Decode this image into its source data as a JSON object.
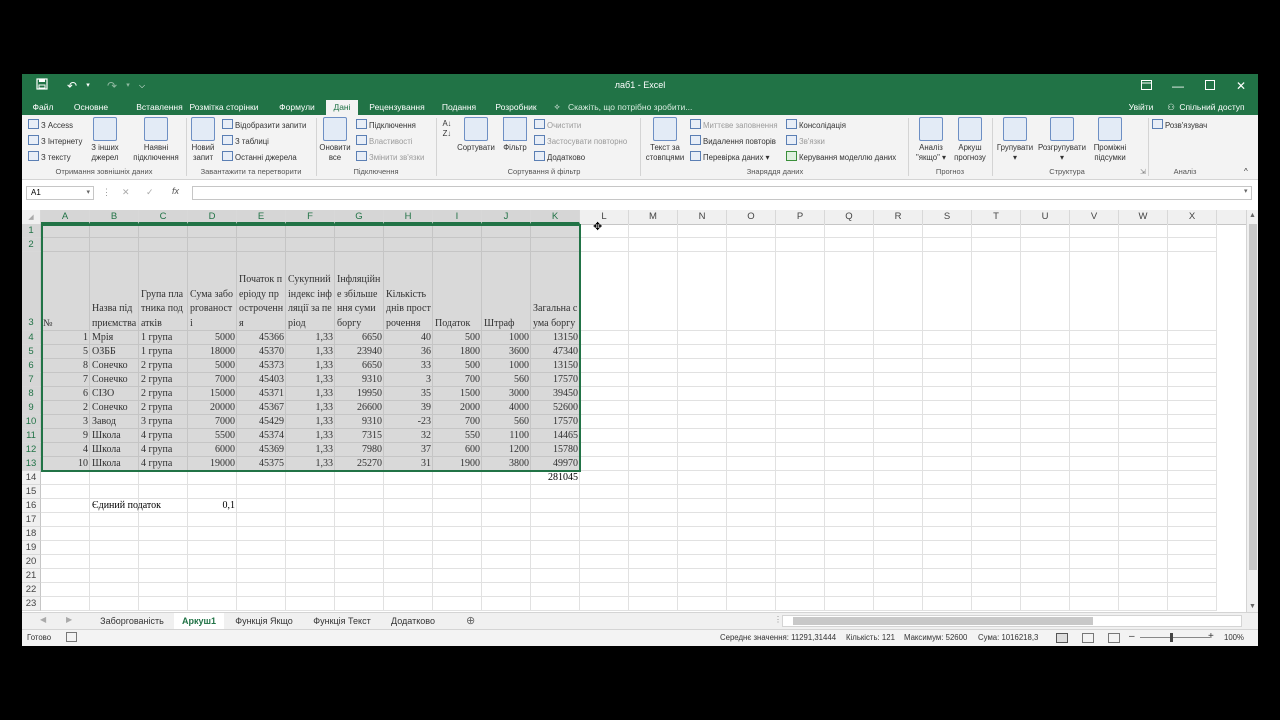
{
  "window": {
    "title": "лаб1 - Excel",
    "ribbon_display_icon": "ribbon-display-icon",
    "accent_color": "#217346"
  },
  "menu_tabs": [
    "Файл",
    "Основне",
    "Вставлення",
    "Розмітка сторінки",
    "Формули",
    "Дані",
    "Рецензування",
    "Подання",
    "Розробник"
  ],
  "active_tab": "Дані",
  "tell_me": "Скажіть, що потрібно зробити...",
  "signin": "Увійти",
  "share": "Спільний доступ",
  "ribbon": {
    "get_external": {
      "items": [
        "З Access",
        "З Інтернету",
        "З тексту"
      ],
      "big": "З інших джерел",
      "big2": "Наявні підключення",
      "label": "Отримання зовнішніх даних"
    },
    "transform": {
      "big": "Новий запит",
      "items": [
        "Відобразити запити",
        "З таблиці",
        "Останні джерела"
      ],
      "label": "Завантажити та перетворити"
    },
    "connections": {
      "big": "Оновити все",
      "items": [
        "Підключення",
        "Властивості",
        "Змінити зв'язки"
      ],
      "label": "Підключення"
    },
    "sort_filter": {
      "sort": "Сортувати",
      "filter": "Фільтр",
      "items": [
        "Очистити",
        "Застосувати повторно",
        "Додатково"
      ],
      "label": "Сортування й фільтр"
    },
    "data_tools": {
      "big": "Текст за стовпцями",
      "items": [
        "Миттєве заповнення",
        "Видалення повторів",
        "Перевірка даних"
      ],
      "items2": [
        "Консолідація",
        "Зв'язки",
        "Керування моделлю даних"
      ],
      "label": "Знаряддя даних"
    },
    "forecast": {
      "big1": "Аналіз \"якщо\"",
      "big2": "Аркуш прогнозу",
      "label": "Прогноз"
    },
    "outline": {
      "big1": "Групувати",
      "big2": "Розгрупувати",
      "big3": "Проміжні підсумки",
      "label": "Структура"
    },
    "analysis": {
      "item": "Розв'язувач",
      "label": "Аналіз"
    }
  },
  "formula_bar": {
    "name_box": "A1",
    "fx": "fx",
    "formula": ""
  },
  "columns": [
    "A",
    "B",
    "C",
    "D",
    "E",
    "F",
    "G",
    "H",
    "I",
    "J",
    "K",
    "L",
    "M",
    "N",
    "O",
    "P",
    "Q",
    "R",
    "S",
    "T",
    "U",
    "V",
    "W",
    "X"
  ],
  "rows": [
    "1",
    "2",
    "3",
    "4",
    "5",
    "6",
    "7",
    "8",
    "9",
    "10",
    "11",
    "12",
    "13",
    "14",
    "15",
    "16",
    "17",
    "18",
    "19",
    "20",
    "21",
    "22",
    "23"
  ],
  "table": {
    "headers": [
      "№",
      "Назва підприємства",
      "Група платника податків",
      "Сума заборгованості",
      "Початок періоду прострочення",
      "Сукупний індекс інфляції за період",
      "Інфляційне збільшення суми боргу",
      "Кількість днів прострочення",
      "Податок",
      "Штраф",
      "Загальна сума боргу"
    ],
    "rows": [
      [
        "1",
        "Мрія",
        "1 група",
        "5000",
        "45366",
        "1,33",
        "6650",
        "40",
        "500",
        "1000",
        "13150"
      ],
      [
        "5",
        "ОЗББ",
        "1 група",
        "18000",
        "45370",
        "1,33",
        "23940",
        "36",
        "1800",
        "3600",
        "47340"
      ],
      [
        "8",
        "Сонечко",
        "2 група",
        "5000",
        "45373",
        "1,33",
        "6650",
        "33",
        "500",
        "1000",
        "13150"
      ],
      [
        "7",
        "Сонечко",
        "2 група",
        "7000",
        "45403",
        "1,33",
        "9310",
        "3",
        "700",
        "560",
        "17570"
      ],
      [
        "6",
        "СІЗО",
        "2 група",
        "15000",
        "45371",
        "1,33",
        "19950",
        "35",
        "1500",
        "3000",
        "39450"
      ],
      [
        "2",
        "Сонечко",
        "2 група",
        "20000",
        "45367",
        "1,33",
        "26600",
        "39",
        "2000",
        "4000",
        "52600"
      ],
      [
        "3",
        "Завод",
        "3 група",
        "7000",
        "45429",
        "1,33",
        "9310",
        "-23",
        "700",
        "560",
        "17570"
      ],
      [
        "9",
        "Школа",
        "4 група",
        "5500",
        "45374",
        "1,33",
        "7315",
        "32",
        "550",
        "1100",
        "14465"
      ],
      [
        "4",
        "Школа",
        "4 група",
        "6000",
        "45369",
        "1,33",
        "7980",
        "37",
        "600",
        "1200",
        "15780"
      ],
      [
        "10",
        "Школа",
        "4 група",
        "19000",
        "45375",
        "1,33",
        "25270",
        "31",
        "1900",
        "3800",
        "49970"
      ]
    ],
    "total": "281045",
    "single_tax_label": "Єдиний податок",
    "single_tax_value": "0,1"
  },
  "sheet_tabs": [
    "Заборгованість",
    "Аркуш1",
    "Функція Якщо",
    "Функція Текст",
    "Додатково"
  ],
  "active_sheet": "Аркуш1",
  "status": {
    "ready": "Готово",
    "average": "Середнє значення: 11291,31444",
    "count": "Кількість: 121",
    "max": "Максимум: 52600",
    "sum": "Сума: 1016218,3",
    "zoom": "100%"
  }
}
